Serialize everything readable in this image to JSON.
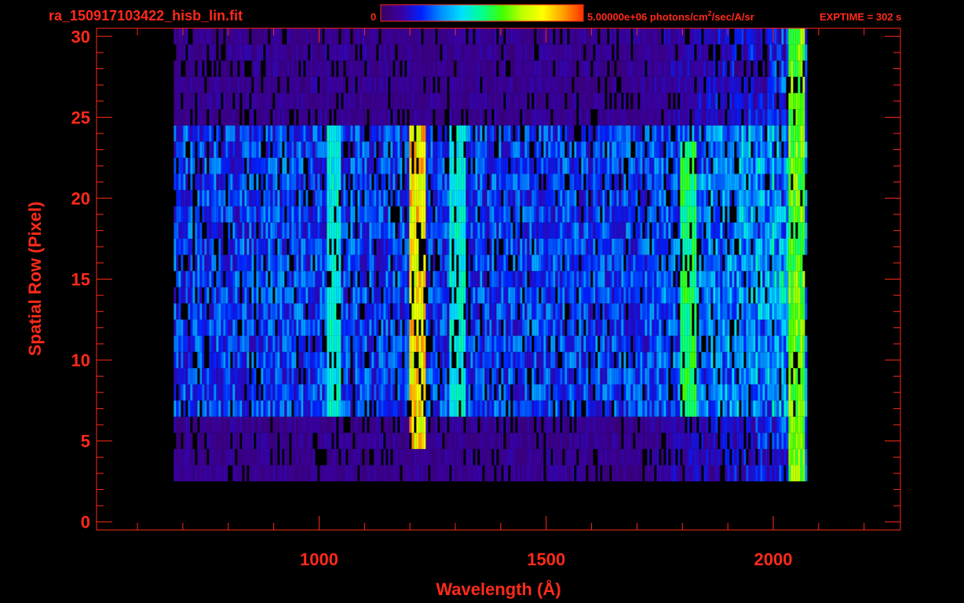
{
  "title": "ra_150917103422_hisb_lin.fit",
  "colorbar": {
    "min_label": "0",
    "max_label": "5.00000e+06 photons/cm",
    "max_label_sup": "2",
    "max_label_rest": "/sec/A/sr",
    "stops": [
      "#3a0060",
      "#3a00a0",
      "#0020ff",
      "#0090ff",
      "#00e0ff",
      "#00ff90",
      "#40ff00",
      "#c0ff00",
      "#ffff00",
      "#ffa000",
      "#ff3000"
    ]
  },
  "exptime": "EXPTIME = 302 s",
  "colors": {
    "axis": "#ff2a1a",
    "background": "#000000"
  },
  "chart_data": {
    "type": "heatmap",
    "xlabel": "Wavelength (Å)",
    "ylabel": "Spatial Row (Pixel)",
    "xlim": [
      510,
      2280
    ],
    "ylim": [
      -0.5,
      30.5
    ],
    "xticks": [
      1000,
      1500,
      2000
    ],
    "yticks": [
      0,
      5,
      10,
      15,
      20,
      25,
      30
    ],
    "data_extent": {
      "wavelength": [
        680,
        2070
      ],
      "rows": [
        3,
        30
      ]
    },
    "emission_lines": [
      {
        "wavelength": 1030,
        "rows": [
          7,
          24
        ],
        "intensity": 0.45
      },
      {
        "wavelength": 1216,
        "rows": [
          5,
          24
        ],
        "intensity": 0.85
      },
      {
        "wavelength": 1304,
        "rows": [
          7,
          24
        ],
        "intensity": 0.45
      },
      {
        "wavelength": 1810,
        "rows": [
          7,
          23
        ],
        "intensity": 0.55
      },
      {
        "wavelength": 2050,
        "rows": [
          3,
          30
        ],
        "intensity": 0.65
      }
    ]
  }
}
